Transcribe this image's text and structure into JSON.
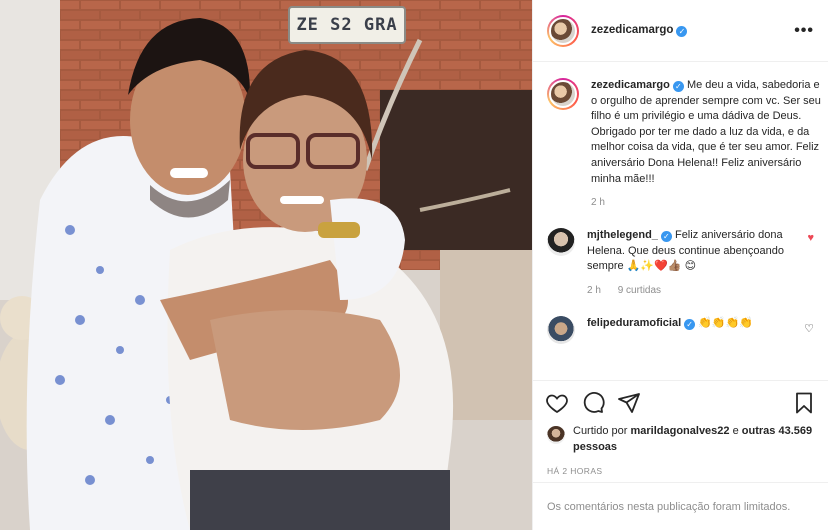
{
  "photo": {
    "plate_text": "ZE S2 GRA",
    "alt": "Photo"
  },
  "header": {
    "username": "zezedicamargo",
    "verified_glyph": "✓",
    "more_glyph": "•••"
  },
  "caption": {
    "username": "zezedicamargo",
    "text": "Me deu a vida, sabedoria e o orgulho de aprender sempre com vc. Ser seu filho é um privilégio e uma dádiva de Deus. Obrigado por ter me dado a luz da vida, e da melhor coisa da vida, que é ter seu amor. Feliz aniversário Dona Helena!! Feliz aniversário minha mãe!!!",
    "time": "2 h"
  },
  "comments": [
    {
      "username": "mjthelegend_",
      "text": "Feliz aniversário dona Helena. Que deus continue abençoando sempre 🙏✨❤️👍🏽 😊",
      "time": "2 h",
      "likes": "9 curtidas",
      "liked": true
    },
    {
      "username": "felipeduramoficial",
      "text": "👏👏👏👏",
      "liked": false
    }
  ],
  "actions": {
    "like_icon": "heart-outline-icon",
    "comment_icon": "comment-bubble-icon",
    "share_icon": "paper-plane-icon",
    "save_icon": "bookmark-icon"
  },
  "likes": {
    "prefix": "Curtido por",
    "user": "marildagonalves22",
    "joiner": "e",
    "others": "outras 43.569 pessoas"
  },
  "posted_ago": "HÁ 2 HORAS",
  "comments_limited": "Os comentários nesta publicação foram limitados.",
  "colors": {
    "verified": "#3897f0",
    "like_red": "#ed4956",
    "muted": "#8e8e8e",
    "text": "#262626",
    "divider": "#efefef"
  }
}
